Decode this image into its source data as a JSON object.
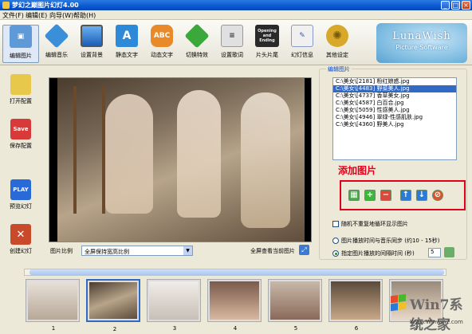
{
  "window": {
    "title": "梦幻之巅图片幻灯4.00"
  },
  "menu": [
    "文件(F)",
    "编辑(E)",
    "向导(W)",
    "帮助(H)"
  ],
  "toolbar": {
    "items": [
      {
        "label": "编辑图片",
        "icon": "edit-picture-icon",
        "color": "#4a8ad0"
      },
      {
        "label": "编辑音乐",
        "icon": "music-icon",
        "color": "#3a8fd8"
      },
      {
        "label": "设置背景",
        "icon": "monitor-icon",
        "color": "#2a6fc8"
      },
      {
        "label": "静态文字",
        "icon": "static-text-icon",
        "color": "#2e8ad8"
      },
      {
        "label": "动态文字",
        "icon": "dynamic-text-icon",
        "color": "#e88a2a"
      },
      {
        "label": "切换特效",
        "icon": "transition-icon",
        "color": "#3aa83a"
      },
      {
        "label": "设置歌词",
        "icon": "lyrics-icon",
        "color": "#c8c8c8"
      },
      {
        "label": "片头片尾",
        "icon": "film-icon",
        "color": "#3a3a3a"
      },
      {
        "label": "幻灯信息",
        "icon": "info-icon",
        "color": "#6a8ac8"
      },
      {
        "label": "其他设定",
        "icon": "gear-icon",
        "color": "#d8a82a"
      }
    ],
    "ic_text": {
      "static": "A",
      "dynamic": "ABC",
      "film": "Opening and Ending"
    }
  },
  "logo": {
    "line1": "LunaWish",
    "line2": "Picture Software"
  },
  "left": {
    "open": "打开配置",
    "save": "保存配置",
    "preview": "预览幻灯",
    "create": "创建幻灯",
    "save_ic": "Save",
    "play_ic": "PLAY"
  },
  "preview": {
    "ratio_label": "图片比例",
    "ratio_value": "全屏保持宽高比例",
    "fullscreen_label": "全屏查看当前图片"
  },
  "panel": {
    "legend": "编辑图片",
    "files": [
      "C:\\美女\\[2181] 粉红娘惑.jpg",
      "C:\\美女\\[4483] 野菜美人.jpg",
      "C:\\美女\\[4737] 香草美女.jpg",
      "C:\\美女\\[4587] 白百合.jpg",
      "C:\\美女\\[5059] 性感美人.jpg",
      "C:\\美女\\[4946] 翠绿-性感肌肤.jpg",
      "C:\\美女\\[4360] 野美人.jpg"
    ],
    "selected_index": 1,
    "add_label": "添加图片",
    "opt_random": "随机不重复地循环显示图片",
    "opt_sync": "图片播放时间与音乐同步 (约10 - 15秒)",
    "opt_interval": "指定图片播放的间隔时间 (秒)",
    "interval_value": "5"
  },
  "thumbs": [
    "1",
    "2",
    "3",
    "4",
    "5",
    "6",
    "7"
  ],
  "watermark": {
    "brand": "Win7系统之家",
    "url": "Www.Winwin7.com"
  }
}
